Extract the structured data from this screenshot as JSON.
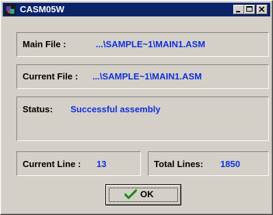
{
  "window": {
    "title": "CASM05W",
    "icon": "casm-app-icon",
    "controls": [
      "minimize-icon",
      "maximize-icon",
      "close-icon"
    ]
  },
  "main_file": {
    "label": "Main File :",
    "value": "...\\SAMPLE~1\\MAIN1.ASM"
  },
  "current_file": {
    "label": "Current File :",
    "value": "...\\SAMPLE~1\\MAIN1.ASM"
  },
  "status": {
    "label": "Status:",
    "value": "Successful assembly"
  },
  "current_line": {
    "label": "Current Line :",
    "value": "13"
  },
  "total_lines": {
    "label": "Total Lines:",
    "value": "1850"
  },
  "ok_button": {
    "label": "OK",
    "icon": "checkmark-icon"
  },
  "colors": {
    "title_bar": "#0a246a",
    "value_text": "#1030e0",
    "face": "#d4d0c8"
  }
}
